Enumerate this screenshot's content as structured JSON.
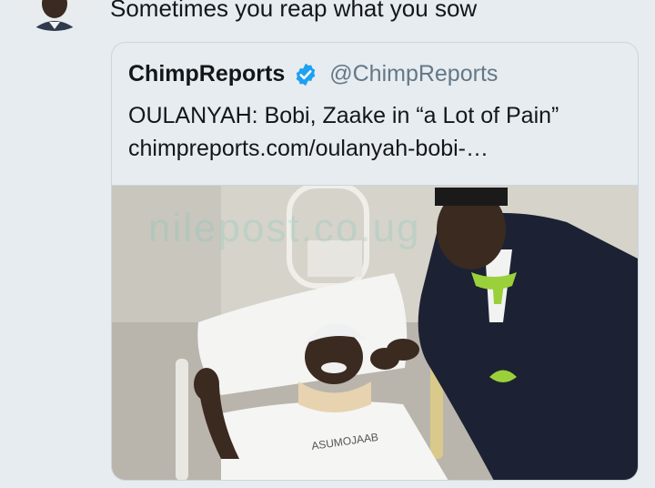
{
  "tweet": {
    "text": "Sometimes you reap what you sow"
  },
  "quoted": {
    "display_name": "ChimpReports",
    "handle": "@ChimpReports",
    "title": "OULANYAH: Bobi, Zaake in “a Lot of Pain”",
    "link": "chimpreports.com/oulanyah-bobi-…",
    "watermark": "nilepost.co.ug",
    "shirt_text": "ASUMOJAAB"
  },
  "colors": {
    "verified": "#1da1f2",
    "background": "#e6ecf0",
    "border": "#ccd6dd",
    "secondary_text": "#657786"
  }
}
